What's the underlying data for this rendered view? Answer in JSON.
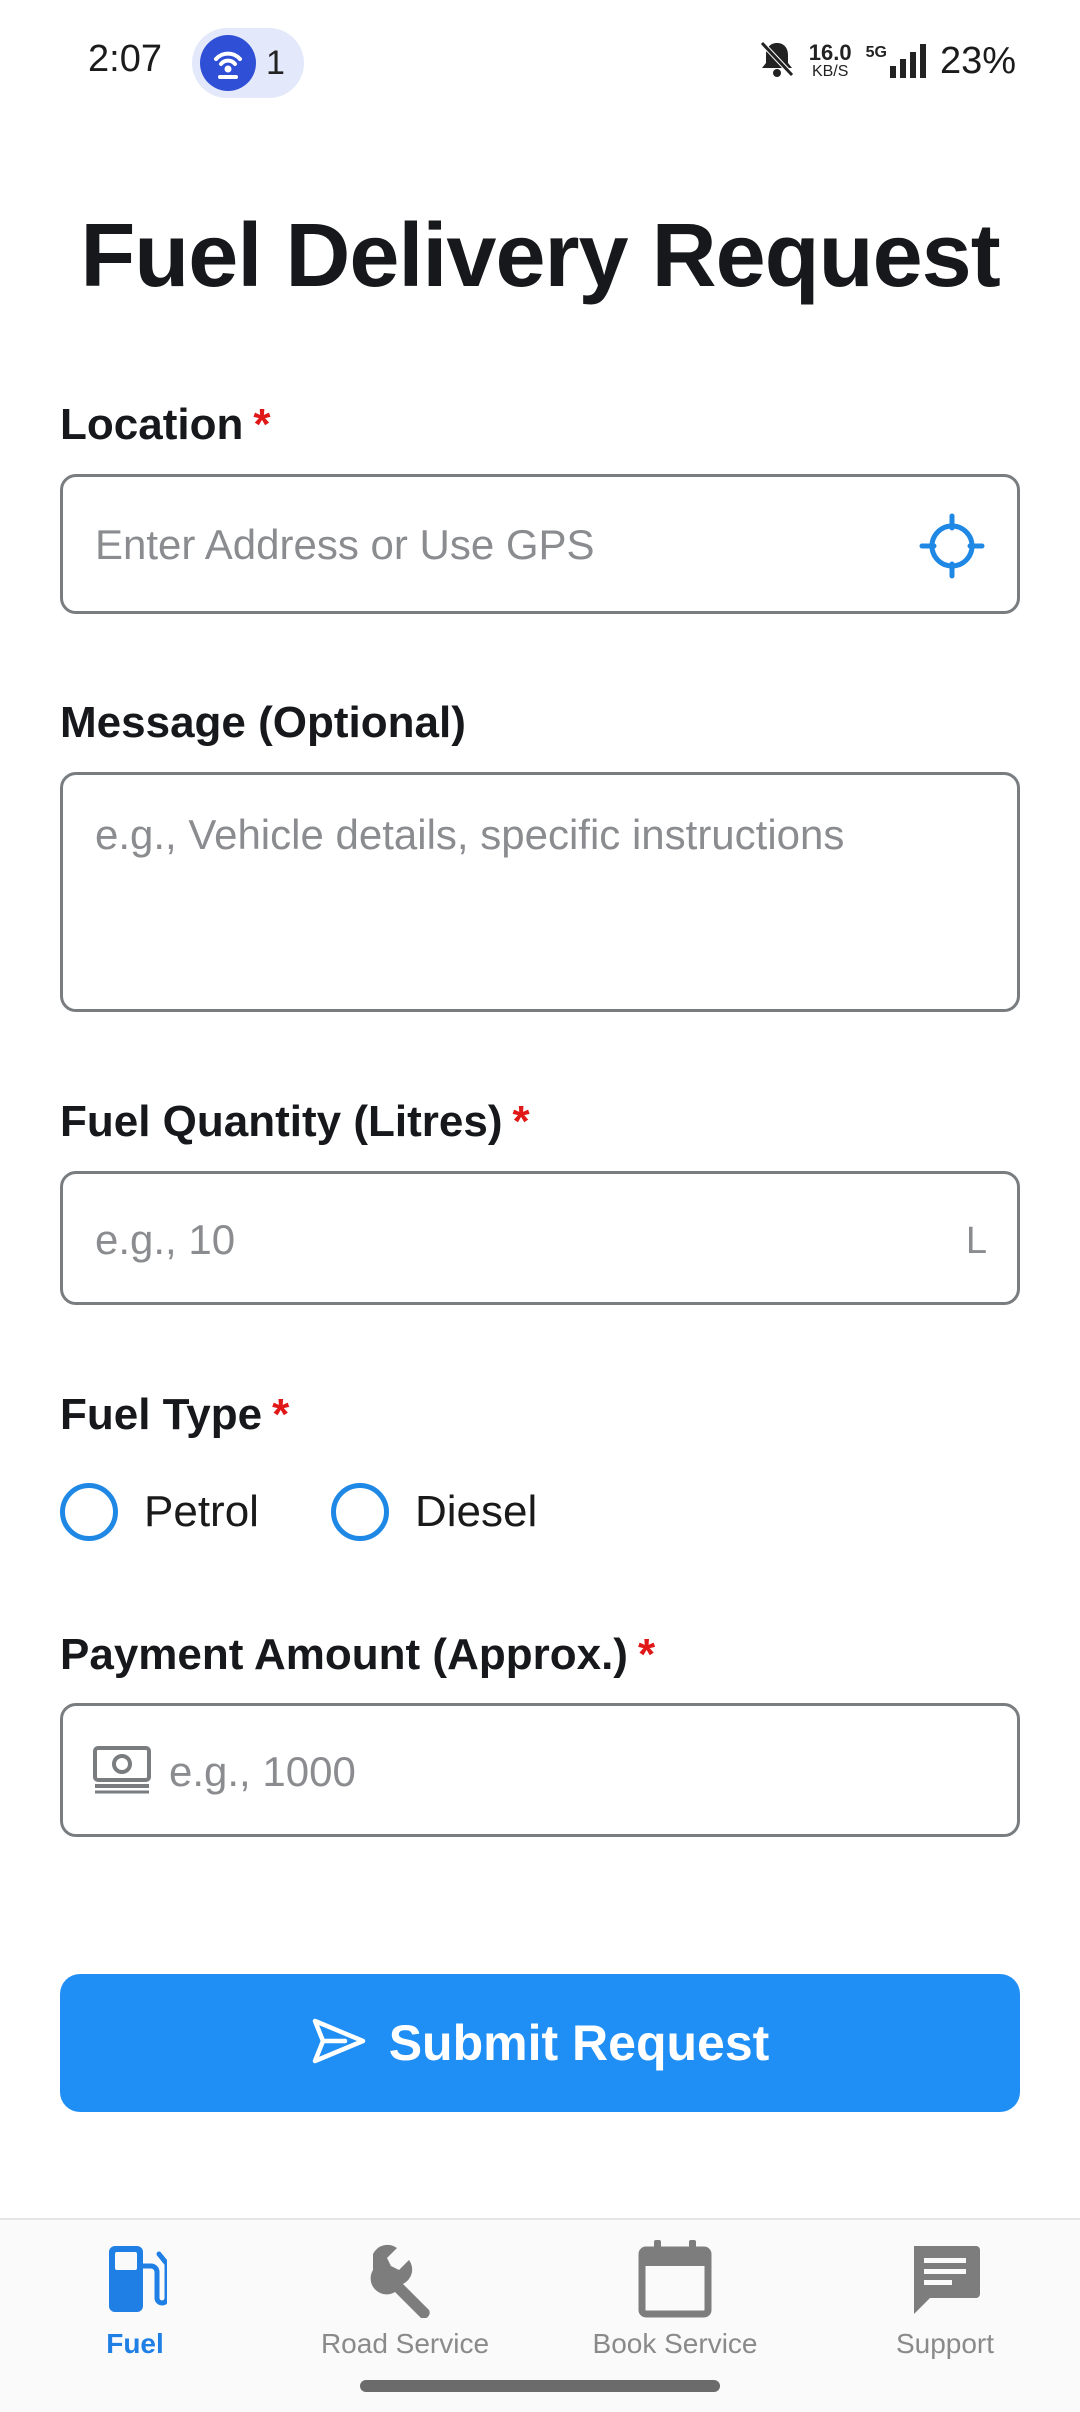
{
  "status_bar": {
    "time": "2:07",
    "hotspot_count": "1",
    "speed_value": "16.0",
    "speed_unit": "KB/S",
    "network": "5G",
    "battery": "23%"
  },
  "page": {
    "title": "Fuel Delivery Request"
  },
  "form": {
    "location": {
      "label": "Location",
      "required_mark": "*",
      "placeholder": "Enter Address or Use GPS",
      "gps_icon": "crosshair-gps-icon"
    },
    "message": {
      "label": "Message (Optional)",
      "placeholder": "e.g., Vehicle details, specific instructions"
    },
    "fuel_quantity": {
      "label": "Fuel Quantity (Litres)",
      "required_mark": "*",
      "placeholder": "e.g., 10",
      "suffix": "L"
    },
    "fuel_type": {
      "label": "Fuel Type",
      "required_mark": "*",
      "options": [
        "Petrol",
        "Diesel"
      ]
    },
    "payment": {
      "label": "Payment Amount (Approx.)",
      "required_mark": "*",
      "placeholder": "e.g., 1000",
      "icon": "cash-icon"
    },
    "submit_label": "Submit Request"
  },
  "bottom_nav": {
    "items": [
      {
        "label": "Fuel",
        "icon": "fuel-pump-icon",
        "active": true
      },
      {
        "label": "Road Service",
        "icon": "wrench-icon",
        "active": false
      },
      {
        "label": "Book Service",
        "icon": "calendar-icon",
        "active": false
      },
      {
        "label": "Support",
        "icon": "chat-icon",
        "active": false
      }
    ]
  },
  "colors": {
    "primary": "#1f8ff5",
    "required": "#e01818",
    "nav_active": "#1f7fe5",
    "nav_inactive": "#7d7d7d"
  }
}
